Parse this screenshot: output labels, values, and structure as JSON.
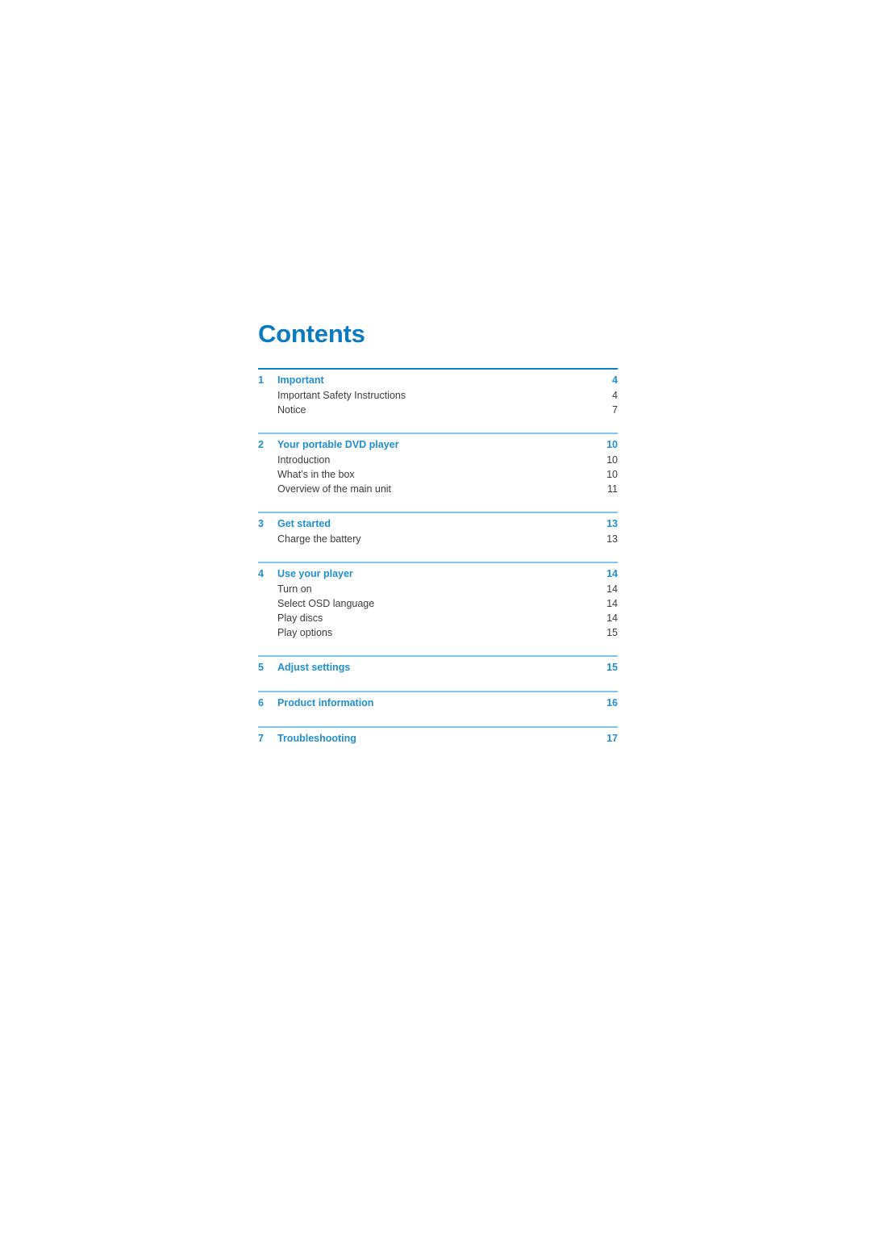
{
  "page": {
    "title": "Contents"
  },
  "colors": {
    "title_blue": "#0b7ac0",
    "heading_blue": "#1f8fd0",
    "rule_strong": "#0f80c8",
    "rule_light": "#7fc4e8",
    "body_text": "#3c3c3c"
  },
  "toc": {
    "sections": [
      {
        "number": "1",
        "label": "Important",
        "page": "4",
        "items": [
          {
            "label": "Important Safety Instructions",
            "page": "4"
          },
          {
            "label": "Notice",
            "page": "7"
          }
        ]
      },
      {
        "number": "2",
        "label": "Your portable DVD player",
        "page": "10",
        "items": [
          {
            "label": "Introduction",
            "page": "10"
          },
          {
            "label": "What’s in the box",
            "page": "10"
          },
          {
            "label": "Overview of the main unit",
            "page": "11"
          }
        ]
      },
      {
        "number": "3",
        "label": "Get started",
        "page": "13",
        "items": [
          {
            "label": "Charge the battery",
            "page": "13"
          }
        ]
      },
      {
        "number": "4",
        "label": "Use your player",
        "page": "14",
        "items": [
          {
            "label": "Turn on",
            "page": "14"
          },
          {
            "label": "Select OSD language",
            "page": "14"
          },
          {
            "label": "Play discs",
            "page": "14"
          },
          {
            "label": "Play options",
            "page": "15"
          }
        ]
      },
      {
        "number": "5",
        "label": "Adjust settings",
        "page": "15",
        "items": []
      },
      {
        "number": "6",
        "label": "Product information",
        "page": "16",
        "items": []
      },
      {
        "number": "7",
        "label": "Troubleshooting",
        "page": "17",
        "items": []
      }
    ]
  }
}
